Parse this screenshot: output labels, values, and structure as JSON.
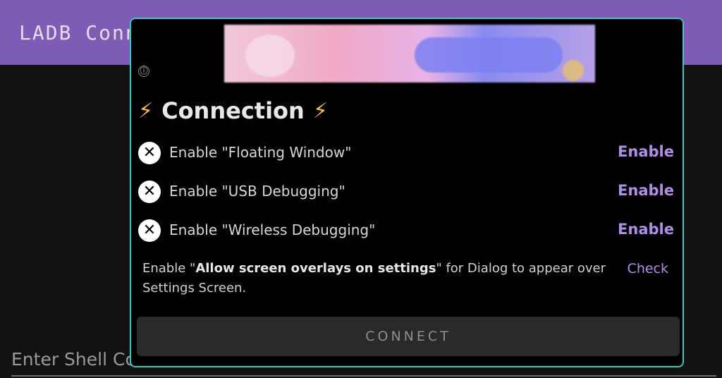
{
  "app": {
    "title": "LADB Conn"
  },
  "shell": {
    "hint": "Enter Shell Co"
  },
  "dialog": {
    "info_icon": "ⓘ",
    "heading": {
      "text": "Connection",
      "icon": "⚡"
    },
    "steps": [
      {
        "label": "Enable \"Floating Window\"",
        "action": "Enable",
        "status_icon": "✕"
      },
      {
        "label": "Enable \"USB Debugging\"",
        "action": "Enable",
        "status_icon": "✕"
      },
      {
        "label": "Enable \"Wireless Debugging\"",
        "action": "Enable",
        "status_icon": "✕"
      }
    ],
    "note": {
      "prefix": "Enable \"",
      "bold": "Allow screen overlays on settings",
      "suffix": "\" for Dialog to appear over Settings Screen."
    },
    "check_label": "Check",
    "connect_label": "CONNECT"
  },
  "colors": {
    "accent": "#b08ee8",
    "appbar": "#7e5cb6",
    "dialog_border": "#3cc8c0",
    "bolt": "#f2c230"
  }
}
